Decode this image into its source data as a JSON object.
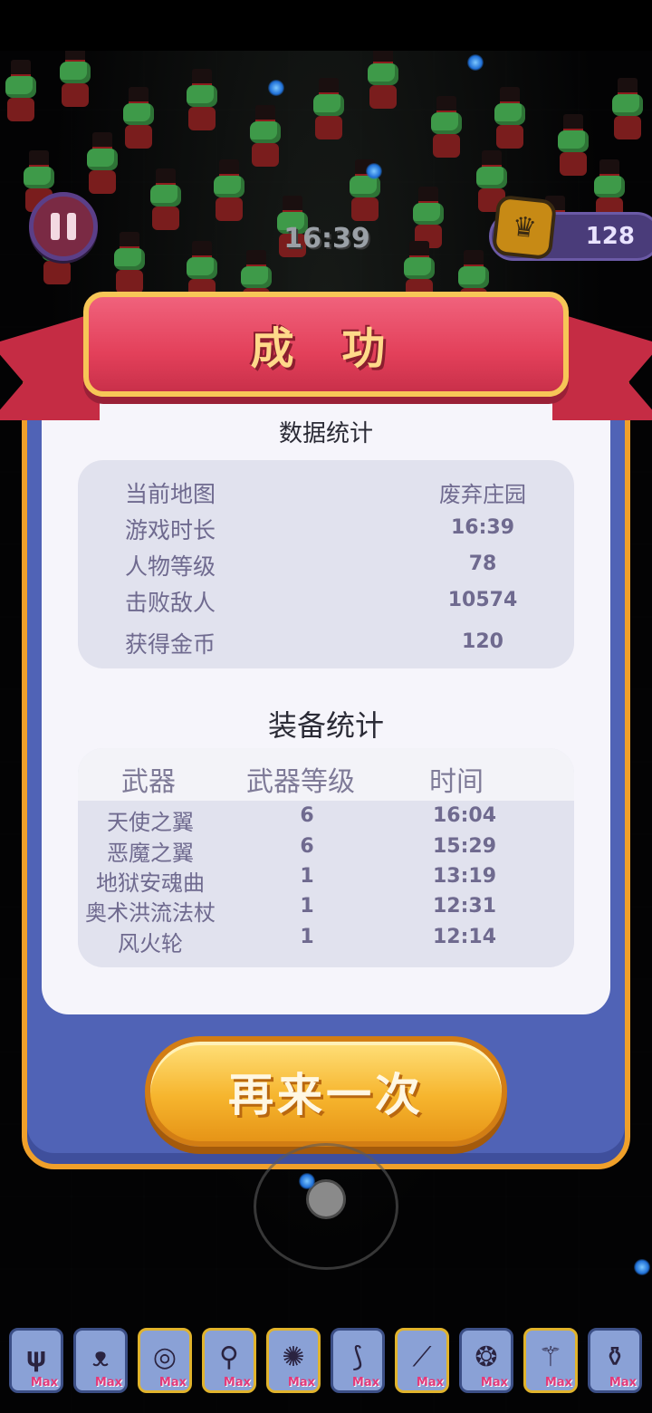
{
  "hud": {
    "timer": "16:39",
    "coins": "128"
  },
  "result": {
    "title": "成 功",
    "data_section_title": "数据统计",
    "stats": [
      {
        "label": "当前地图",
        "value": "废弃庄园"
      },
      {
        "label": "游戏时长",
        "value": "16:39"
      },
      {
        "label": "人物等级",
        "value": "78"
      },
      {
        "label": "击败敌人",
        "value": "10574"
      },
      {
        "label": "获得金币",
        "value": "120"
      }
    ],
    "equipment_section_title": "装备统计",
    "equipment_headers": {
      "weapon": "武器",
      "level": "武器等级",
      "time": "时间"
    },
    "equipment": [
      {
        "name": "天使之翼",
        "level": "6",
        "time": "16:04"
      },
      {
        "name": "恶魔之翼",
        "level": "6",
        "time": "15:29"
      },
      {
        "name": "地狱安魂曲",
        "level": "1",
        "time": "13:19"
      },
      {
        "name": "奥术洪流法杖",
        "level": "1",
        "time": "12:31"
      },
      {
        "name": "风火轮",
        "level": "1",
        "time": "12:14"
      }
    ],
    "retry_label": "再来一次"
  },
  "slots": [
    {
      "icon": "angel-wings-icon",
      "glyph": "𝛙",
      "badge": "Max",
      "border": "blue"
    },
    {
      "icon": "demon-wings-icon",
      "glyph": "ᴥ",
      "badge": "Max",
      "border": "blue"
    },
    {
      "icon": "requiem-disc-icon",
      "glyph": "◎",
      "badge": "Max",
      "border": "gold"
    },
    {
      "icon": "staff-orb-icon",
      "glyph": "⚲",
      "badge": "Max",
      "border": "gold"
    },
    {
      "icon": "fire-wheel-icon",
      "glyph": "✺",
      "badge": "Max",
      "border": "gold"
    },
    {
      "icon": "claw-icon",
      "glyph": "⟆",
      "badge": "Max",
      "border": "blue"
    },
    {
      "icon": "knife-icon",
      "glyph": "⟋",
      "badge": "Max",
      "border": "gold"
    },
    {
      "icon": "blue-orb-icon",
      "glyph": "❂",
      "badge": "Max",
      "border": "blue"
    },
    {
      "icon": "arcane-staff-icon",
      "glyph": "⚚",
      "badge": "Max",
      "border": "gold"
    },
    {
      "icon": "potion-icon",
      "glyph": "⚱",
      "badge": "Max",
      "border": "blue"
    }
  ]
}
